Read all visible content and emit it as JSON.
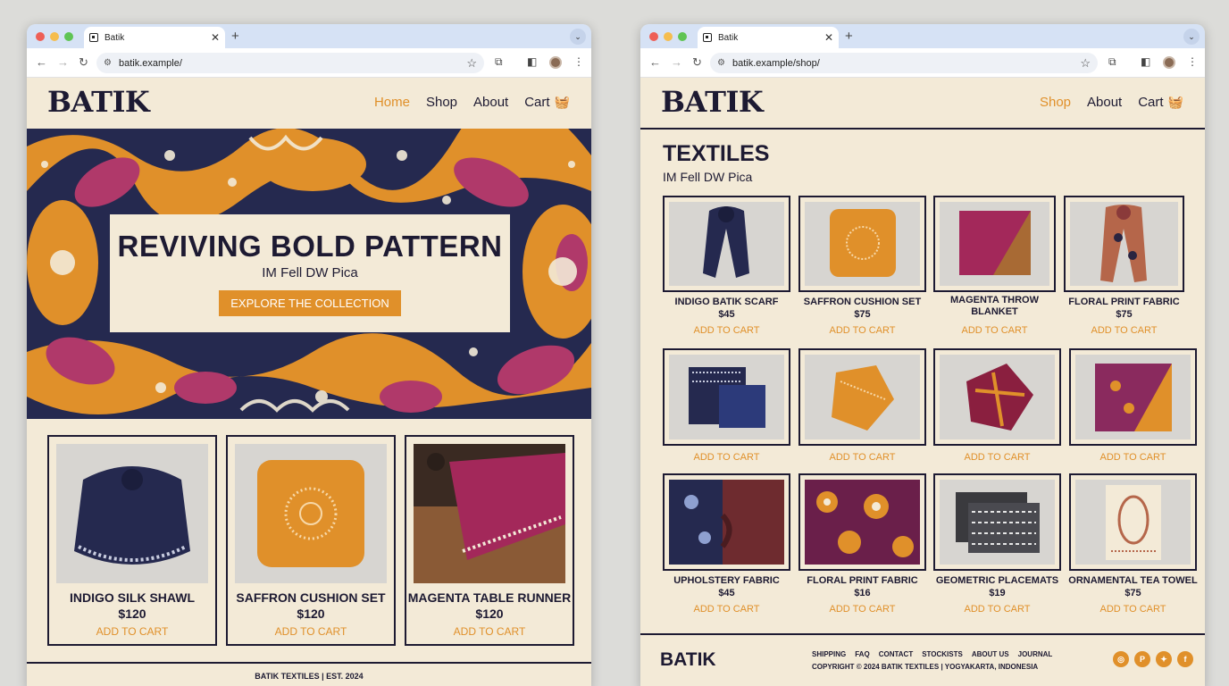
{
  "left_browser": {
    "tab_title": "Batik",
    "url": "batik.example/"
  },
  "right_browser": {
    "tab_title": "Batik",
    "url": "batik.example/shop/"
  },
  "header": {
    "logo": "BATIK",
    "nav_home": "Home",
    "nav_shop": "Shop",
    "nav_about": "About",
    "nav_cart": "Cart"
  },
  "hero": {
    "title": "REVIVING BOLD PATTERN",
    "subtitle": "IM Fell DW Pica",
    "cta": "EXPLORE THE COLLECTION"
  },
  "featured": [
    {
      "name": "INDIGO SILK SHAWL",
      "price": "$120",
      "action": "ADD TO CART"
    },
    {
      "name": "SAFFRON CUSHION SET",
      "price": "$120",
      "action": "ADD TO CART"
    },
    {
      "name": "MAGENTA TABLE RUNNER",
      "price": "$120",
      "action": "ADD TO CART"
    }
  ],
  "left_footer": "BATIK TEXTILES | EST. 2024",
  "shop": {
    "title": "TEXTILES",
    "subtitle": "IM Fell DW Pica",
    "products": [
      {
        "name": "INDIGO BATIK SCARF",
        "price": "$45",
        "action": "ADD TO CART"
      },
      {
        "name": "SAFFRON CUSHION SET",
        "price": "$75",
        "action": "ADD TO CART"
      },
      {
        "name": "MAGENTA THROW BLANKET",
        "price": "",
        "action": "ADD TO CART"
      },
      {
        "name": "FLORAL PRINT FABRIC",
        "price": "$75",
        "action": "ADD TO CART"
      },
      {
        "name": "",
        "price": "",
        "action": "ADD TO CART"
      },
      {
        "name": "",
        "price": "",
        "action": "ADD TO CART"
      },
      {
        "name": "",
        "price": "",
        "action": "ADD TO CART"
      },
      {
        "name": "",
        "price": "",
        "action": "ADD TO CART"
      },
      {
        "name": "UPHOLSTERY FABRIC",
        "price": "$45",
        "action": "ADD TO CART"
      },
      {
        "name": "FLORAL PRINT FABRIC",
        "price": "$16",
        "action": "ADD TO CART"
      },
      {
        "name": "GEOMETRIC PLACEMATS",
        "price": "$19",
        "action": "ADD TO CART"
      },
      {
        "name": "ORNAMENTAL TEA TOWEL",
        "price": "$75",
        "action": "ADD TO CART"
      }
    ]
  },
  "footer": {
    "logo": "BATIK",
    "links": [
      "SHIPPING",
      "FAQ",
      "CONTACT",
      "STOCKISTS",
      "ABOUT US",
      "JOURNAL"
    ],
    "copyright": "COPYRIGHT © 2024 BATIK TEXTILES | YOGYAKARTA, INDONESIA"
  },
  "colors": {
    "background": "#f3ead7",
    "ink": "#1d1a32",
    "accent": "#e0902a",
    "magenta": "#b0396a",
    "indigo": "#25294f"
  },
  "icons": {
    "cart": "shopping-basket-icon",
    "socials": [
      "instagram-icon",
      "pinterest-icon",
      "twitter-icon",
      "facebook-icon"
    ]
  }
}
